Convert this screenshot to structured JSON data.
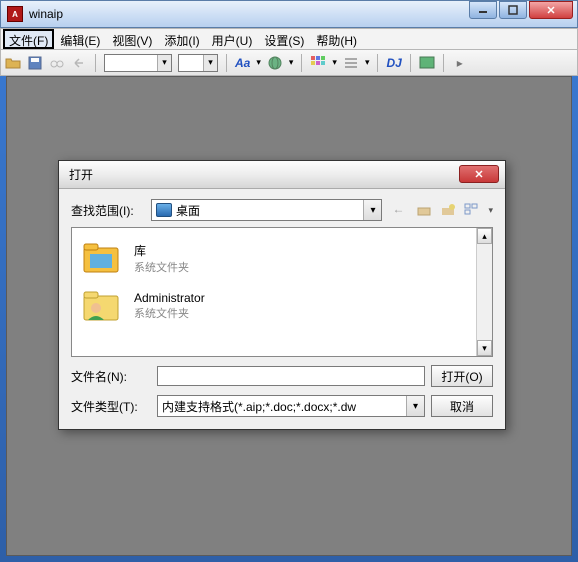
{
  "titlebar": {
    "title": "winaip"
  },
  "menus": [
    {
      "label": "文件(F)",
      "active": true
    },
    {
      "label": "编辑(E)"
    },
    {
      "label": "视图(V)"
    },
    {
      "label": "添加(I)"
    },
    {
      "label": "用户(U)"
    },
    {
      "label": "设置(S)"
    },
    {
      "label": "帮助(H)"
    }
  ],
  "toolbar": {
    "dj_label": "DJ",
    "aa_label": "Aa"
  },
  "dialog": {
    "title": "打开",
    "lookin_label": "查找范围(I):",
    "lookin_value": "桌面",
    "files": [
      {
        "name": "库",
        "type": "系统文件夹",
        "icon": "library"
      },
      {
        "name": "Administrator",
        "type": "系统文件夹",
        "icon": "user"
      }
    ],
    "filename_label": "文件名(N):",
    "filename_value": "",
    "filetype_label": "文件类型(T):",
    "filetype_value": "内建支持格式(*.aip;*.doc;*.docx;*.dw",
    "open_btn": "打开(O)",
    "cancel_btn": "取消"
  }
}
